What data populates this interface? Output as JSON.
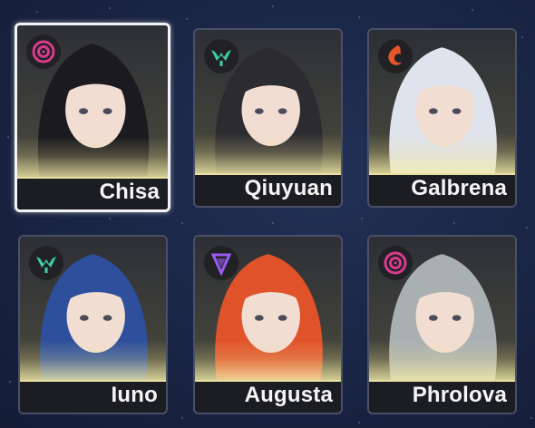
{
  "characters": [
    {
      "name": "Chisa",
      "element_icon": "havoc-icon",
      "element_color": "#d83a8c",
      "hair": "#1a1a1f",
      "selected": true
    },
    {
      "name": "Qiuyuan",
      "element_icon": "aero-icon",
      "element_color": "#3fd19c",
      "hair": "#2b2b30",
      "selected": false
    },
    {
      "name": "Galbrena",
      "element_icon": "fusion-icon",
      "element_color": "#e8552a",
      "hair": "#dfe3ee",
      "selected": false
    },
    {
      "name": "Iuno",
      "element_icon": "aero-icon",
      "element_color": "#3fd19c",
      "hair": "#2d4f9c",
      "selected": false
    },
    {
      "name": "Augusta",
      "element_icon": "electro-icon",
      "element_color": "#9a5cf0",
      "hair": "#e0522a",
      "selected": false
    },
    {
      "name": "Phrolova",
      "element_icon": "havoc-icon",
      "element_color": "#d83a8c",
      "hair": "#a9b0b2",
      "selected": false
    }
  ]
}
